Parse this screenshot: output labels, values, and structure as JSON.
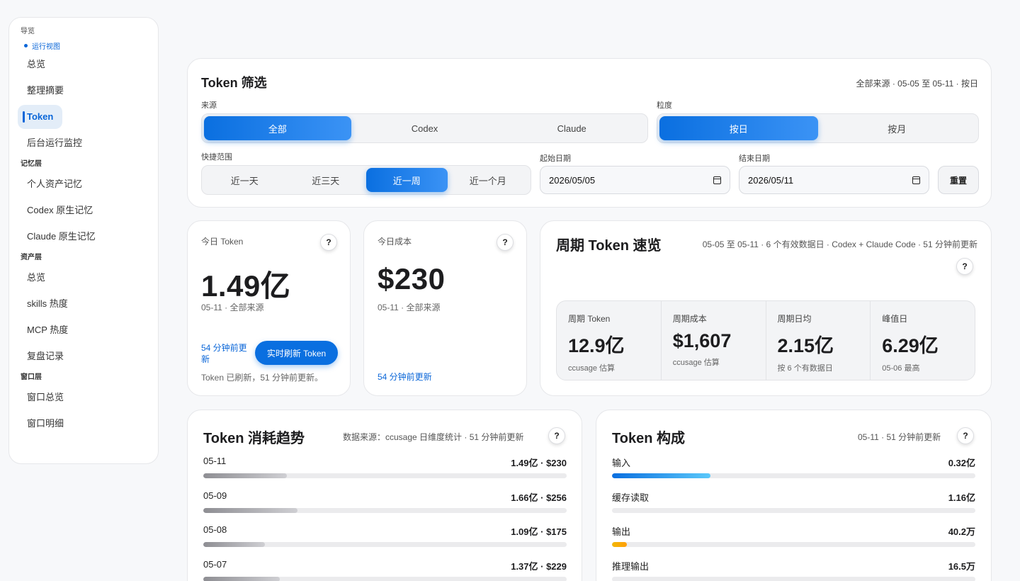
{
  "sidebar": {
    "nav_heading": "导览",
    "current_view": "运行视图",
    "group1": [
      "总览",
      "整理摘要",
      "Token",
      "后台运行监控"
    ],
    "memory_heading": "记忆层",
    "group2": [
      "个人资产记忆",
      "Codex 原生记忆",
      "Claude 原生记忆"
    ],
    "asset_heading": "资产层",
    "group3": [
      "总览",
      "skills 热度",
      "MCP 热度",
      "复盘记录"
    ],
    "window_heading": "窗口层",
    "group4": [
      "窗口总览",
      "窗口明细"
    ]
  },
  "filter": {
    "title": "Token 筛选",
    "summary": "全部来源 · 05-05 至 05-11 · 按日",
    "source_label": "来源",
    "source_options": [
      "全部",
      "Codex",
      "Claude"
    ],
    "source_selected": "全部",
    "granularity_label": "粒度",
    "granularity_options": [
      "按日",
      "按月"
    ],
    "granularity_selected": "按日",
    "range_label": "快捷范围",
    "range_options": [
      "近一天",
      "近三天",
      "近一周",
      "近一个月"
    ],
    "range_selected": "近一周",
    "start_label": "起始日期",
    "start_value": "2026/05/05",
    "end_label": "结束日期",
    "end_value": "2026/05/11",
    "reset_label": "重置"
  },
  "today_token": {
    "label": "今日 Token",
    "value": "1.49亿",
    "note": "05-11 · 全部来源",
    "updated": "54 分钟前更新",
    "refresh_label": "实时刷新 Token",
    "status": "Token 已刷新，51 分钟前更新。"
  },
  "today_cost": {
    "label": "今日成本",
    "value": "$230",
    "note": "05-11 · 全部来源",
    "updated": "54 分钟前更新"
  },
  "overview": {
    "title": "周期 Token 速览",
    "meta": "05-05 至 05-11 · 6 个有效数据日 · Codex + Claude Code · 51 分钟前更新",
    "metrics": [
      {
        "label": "周期 Token",
        "value": "12.9亿",
        "note": "ccusage 估算"
      },
      {
        "label": "周期成本",
        "value": "$1,607",
        "note": "ccusage 估算"
      },
      {
        "label": "周期日均",
        "value": "2.15亿",
        "note": "按 6 个有数据日"
      },
      {
        "label": "峰值日",
        "value": "6.29亿",
        "note": "05-06 最高"
      }
    ]
  },
  "trend": {
    "title": "Token 消耗趋势",
    "meta": "数据来源：ccusage 日维度统计 · 51 分钟前更新",
    "rows": [
      {
        "date": "05-11",
        "value_text": "1.49亿 · $230",
        "fraction": 0.23
      },
      {
        "date": "05-09",
        "value_text": "1.66亿 · $256",
        "fraction": 0.26
      },
      {
        "date": "05-08",
        "value_text": "1.09亿 · $175",
        "fraction": 0.17
      },
      {
        "date": "05-07",
        "value_text": "1.37亿 · $229",
        "fraction": 0.21
      }
    ]
  },
  "composition": {
    "title": "Token 构成",
    "meta": "05-11 · 51 分钟前更新",
    "rows": [
      {
        "label": "输入",
        "value_text": "0.32亿",
        "fraction": 0.27,
        "color": "#1a7fe8"
      },
      {
        "label": "缓存读取",
        "value_text": "1.16亿",
        "fraction": 0.0,
        "color": "#ebebed"
      },
      {
        "label": "输出",
        "value_text": "40.2万",
        "fraction": 0.04,
        "color": "#f2b705"
      },
      {
        "label": "推理输出",
        "value_text": "16.5万",
        "fraction": 0.0,
        "color": "#ebebed"
      }
    ]
  },
  "colors": {
    "accent": "#0a6fe0",
    "trend_bar": "#9a9a9e"
  }
}
